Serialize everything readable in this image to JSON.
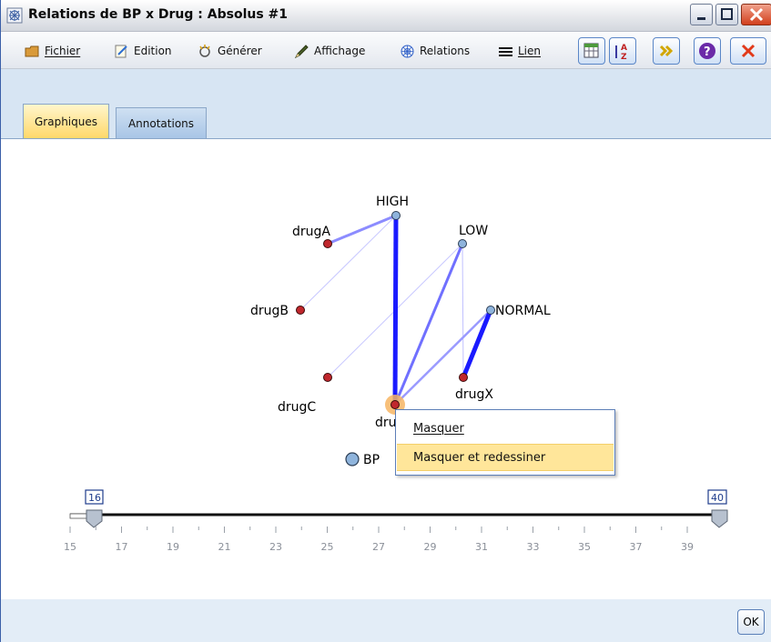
{
  "window": {
    "title": "Relations de BP x Drug : Absolus #1"
  },
  "menu": {
    "fichier": "Fichier",
    "edition": "Edition",
    "generer": "Générer",
    "affichage": "Affichage",
    "relations": "Relations",
    "lien": "Lien"
  },
  "tabs": {
    "graphiques": "Graphiques",
    "annotations": "Annotations"
  },
  "graph": {
    "nodes": {
      "high": "HIGH",
      "low": "LOW",
      "normal": "NORMAL",
      "drugA": "drugA",
      "drugB": "drugB",
      "drugC": "drugC",
      "drugX": "drugX",
      "drugY_partial": "dru"
    },
    "legend": "BP",
    "colors": {
      "bp_node": "#8fb4dc",
      "drug_node": "#c0272d",
      "strong_link": "#1a1aff",
      "weak_link": "#b9b9ff",
      "selected_halo": "#f7b563"
    }
  },
  "slider": {
    "min_value": "16",
    "max_value": "40",
    "ticks": [
      "15",
      "17",
      "19",
      "21",
      "23",
      "25",
      "27",
      "29",
      "31",
      "33",
      "35",
      "37",
      "39"
    ]
  },
  "context_menu": {
    "masquer": "Masquer",
    "masquer_redessiner": "Masquer et redessiner"
  },
  "buttons": {
    "ok": "OK"
  }
}
